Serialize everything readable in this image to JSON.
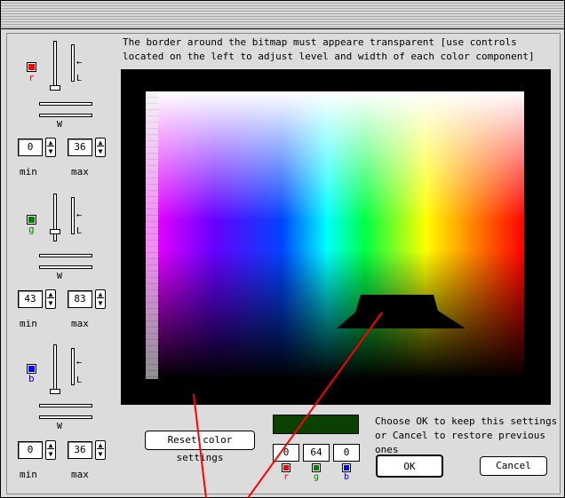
{
  "instructions": "The border around the bitmap must appeare transparent [use controls located on the left to adjust level and width of each color component]",
  "groups": [
    {
      "letter": "r",
      "color": "#ff0000",
      "letter_color": "#ff0000",
      "min": "0",
      "max": "36",
      "l_label": "L",
      "w_label": "W"
    },
    {
      "letter": "g",
      "color": "#008000",
      "letter_color": "#008000",
      "min": "43",
      "max": "83",
      "l_label": "L",
      "w_label": "W"
    },
    {
      "letter": "b",
      "color": "#0000ff",
      "letter_color": "#0000ff",
      "min": "0",
      "max": "36",
      "l_label": "L",
      "w_label": "W"
    }
  ],
  "labels": {
    "min": "min",
    "max": "max"
  },
  "reset_button": "Reset color settings",
  "rgb_values": {
    "r": "0",
    "g": "64",
    "b": "0"
  },
  "rgb_letters": {
    "r": "r",
    "g": "g",
    "b": "b"
  },
  "note": "Choose OK to keep this settings or Cancel to restore previous ones",
  "ok_button": "OK",
  "cancel_button": "Cancel",
  "colors": {
    "preview": "#0a4000",
    "bitmap_border": "#000000",
    "annotation_line": "#ff0000"
  }
}
